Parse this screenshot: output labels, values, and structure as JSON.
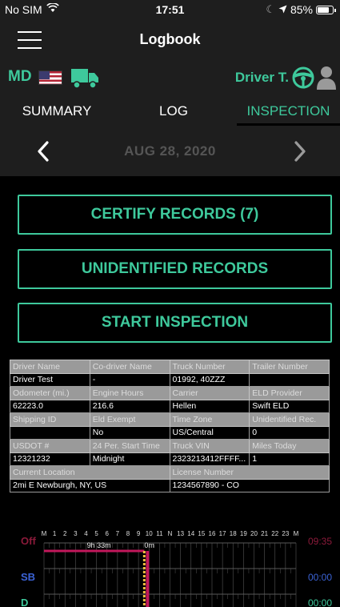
{
  "status_bar": {
    "carrier": "No SIM",
    "time": "17:51",
    "battery": "85%",
    "battery_level": 0.85,
    "icons": [
      "wifi-icon",
      "moon-icon",
      "location-arrow-icon",
      "battery-icon"
    ]
  },
  "nav": {
    "title": "Logbook",
    "menu_icon": "hamburger-icon"
  },
  "driver_bar": {
    "state": "MD",
    "driver": "Driver T.",
    "flag_icon": "us-flag-icon",
    "truck_icon": "truck-icon"
  },
  "tabs": [
    {
      "label": "SUMMARY",
      "active": false
    },
    {
      "label": "LOG",
      "active": false
    },
    {
      "label": "INSPECTION",
      "active": true
    }
  ],
  "date": "AUG 28, 2020",
  "buttons": {
    "certify": "CERTIFY RECORDS (7)",
    "unidentified": "UNIDENTIFIED RECORDS",
    "start_inspection": "START INSPECTION"
  },
  "info_table": {
    "rows": [
      {
        "h": [
          "Driver Name",
          "Co-driver Name",
          "Truck Number",
          "Trailer Number"
        ],
        "v": [
          "Driver Test",
          "-",
          "01992, 40ZZZ",
          ""
        ]
      },
      {
        "h": [
          "Odometer (mi.)",
          "Engine Hours",
          "Carrier",
          "ELD Provider"
        ],
        "v": [
          "62223.0",
          "216.6",
          "Hellen",
          "Swift ELD"
        ]
      },
      {
        "h": [
          "Shipping ID",
          "Eld Exempt",
          "Time Zone",
          "Unidentified Rec."
        ],
        "v": [
          "",
          "No",
          "US/Central",
          "0"
        ]
      },
      {
        "h": [
          "USDOT #",
          "24 Per. Start Time",
          "Truck VIN",
          "Miles Today"
        ],
        "v": [
          "12321232",
          "Midnight",
          "2323213412FFFF...",
          "1"
        ]
      }
    ],
    "last_row": {
      "h": [
        "Current Location",
        "License Number"
      ],
      "v": [
        "2mi E Newburgh, NY, US",
        "1234567890  -  CO"
      ]
    }
  },
  "log_chart": {
    "hour_labels": [
      "M",
      "1",
      "2",
      "3",
      "4",
      "5",
      "6",
      "7",
      "8",
      "9",
      "10",
      "11",
      "N",
      "13",
      "14",
      "15",
      "16",
      "17",
      "18",
      "19",
      "20",
      "21",
      "22",
      "23",
      "M"
    ],
    "statuses": [
      {
        "label": "Off",
        "total": "09:35",
        "color": "#8b1a3a"
      },
      {
        "label": "SB",
        "total": "00:00",
        "color": "#3b63d6"
      },
      {
        "label": "D",
        "total": "00:00",
        "color": "#3ec99c"
      }
    ],
    "segment_labels": {
      "off_duration": "9h 33m",
      "current_duration": "0m"
    },
    "off_duty_end_hour": 9.55,
    "current_hour": 9.86,
    "line_color": "#c2185b",
    "marker_color": "#f0c040"
  },
  "colors": {
    "accent": "#3ec99c",
    "bar_bg": "#1e1e1e",
    "date_text": "#555555"
  }
}
